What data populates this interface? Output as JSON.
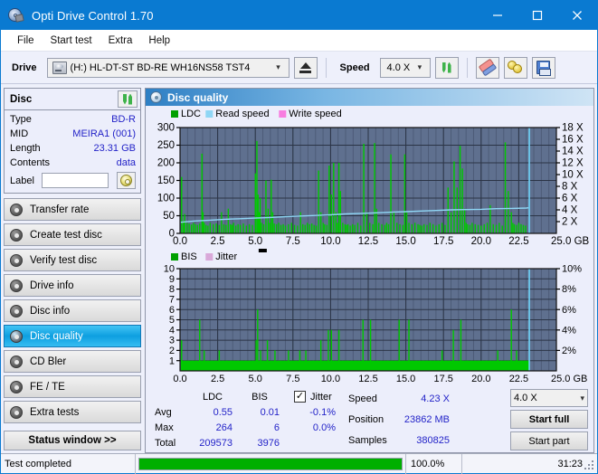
{
  "window": {
    "title": "Opti Drive Control 1.70",
    "icon": "disc-drive-icon",
    "minimize": "minimize-icon",
    "maximize": "maximize-icon",
    "close": "close-icon"
  },
  "menu": {
    "items": [
      {
        "label": "File"
      },
      {
        "label": "Start test"
      },
      {
        "label": "Extra"
      },
      {
        "label": "Help"
      }
    ]
  },
  "toolbar": {
    "drive_label": "Drive",
    "drive_value": "(H:)  HL-DT-ST BD-RE  WH16NS58 TST4",
    "eject_icon": "eject-icon",
    "speed_label": "Speed",
    "speed_value": "4.0 X",
    "refresh_icon": "refresh-icon",
    "eraser_icon": "eraser-icon",
    "coins_icon": "coins-icon",
    "save_icon": "floppy-save-icon"
  },
  "disc_panel": {
    "title": "Disc",
    "refresh_icon": "refresh-icon",
    "rows": [
      {
        "key": "Type",
        "value": "BD-R"
      },
      {
        "key": "MID",
        "value": "MEIRA1 (001)"
      },
      {
        "key": "Length",
        "value": "23.31 GB"
      },
      {
        "key": "Contents",
        "value": "data"
      }
    ],
    "label_key": "Label",
    "label_value": "",
    "label_placeholder": "",
    "label_button_icon": "cd-icon"
  },
  "sidebar": {
    "items": [
      {
        "label": "Transfer rate",
        "icon": "disc-test-icon",
        "active": false
      },
      {
        "label": "Create test disc",
        "icon": "disc-test-icon",
        "active": false
      },
      {
        "label": "Verify test disc",
        "icon": "disc-test-icon",
        "active": false
      },
      {
        "label": "Drive info",
        "icon": "disc-test-icon",
        "active": false
      },
      {
        "label": "Disc info",
        "icon": "disc-test-icon",
        "active": false
      },
      {
        "label": "Disc quality",
        "icon": "disc-test-icon",
        "active": true
      },
      {
        "label": "CD Bler",
        "icon": "disc-test-icon",
        "active": false
      },
      {
        "label": "FE / TE",
        "icon": "disc-test-icon",
        "active": false
      },
      {
        "label": "Extra tests",
        "icon": "disc-test-icon",
        "active": false
      }
    ],
    "status_button": "Status window >>"
  },
  "panel": {
    "title": "Disc quality",
    "icon": "disc-quality-icon"
  },
  "stats": {
    "col_headers": [
      "LDC",
      "BIS"
    ],
    "rows": [
      {
        "label": "Avg",
        "ldc": "0.55",
        "bis": "0.01",
        "jitter": "-0.1%"
      },
      {
        "label": "Max",
        "ldc": "264",
        "bis": "6",
        "jitter": "0.0%"
      },
      {
        "label": "Total",
        "ldc": "209573",
        "bis": "3976",
        "jitter": ""
      }
    ],
    "jitter_label": "Jitter",
    "jitter_checked": "✓",
    "speed_label": "Speed",
    "speed_value": "4.23 X",
    "position_label": "Position",
    "position_value": "23862 MB",
    "samples_label": "Samples",
    "samples_value": "380825",
    "speed_select": "4.0 X",
    "start_full": "Start full",
    "start_part": "Start part"
  },
  "statusbar": {
    "message": "Test completed",
    "percent": "100.0%",
    "progress": 100,
    "elapsed": "31:23"
  },
  "colors": {
    "accent": "#0a7ad1",
    "plot_bg": "#5f708f",
    "grid": "#2b3446",
    "ldc_green": "#00c800",
    "read_speed_blue": "#79d4f7",
    "write_speed_pink": "#f87de0",
    "jitter_pink": "#d9a8d9",
    "value_blue": "#2323c8",
    "progress_green": "#00af00"
  },
  "chart_data": [
    {
      "type": "bar",
      "name": "quality-chart-ldc",
      "title": "",
      "xlabel": "GB",
      "ylabel": "LDC",
      "xlim": [
        0,
        25
      ],
      "ylim": [
        0,
        300
      ],
      "y2lim": [
        0,
        18
      ],
      "y2label": "X",
      "grid": true,
      "legend": [
        "LDC",
        "Read speed",
        "Write speed"
      ],
      "legend_colors": [
        "#00a000",
        "#8fd6f5",
        "#f87de0"
      ],
      "yticks": [
        0,
        50,
        100,
        150,
        200,
        250,
        300
      ],
      "y2ticks": [
        2,
        4,
        6,
        8,
        10,
        12,
        14,
        16,
        18
      ],
      "y2ticklabels": [
        "2 X",
        "4 X",
        "6 X",
        "8 X",
        "10 X",
        "12 X",
        "14 X",
        "16 X",
        "18 X"
      ],
      "xticks": [
        0.0,
        2.5,
        5.0,
        7.5,
        10.0,
        12.5,
        15.0,
        17.5,
        20.0,
        22.5,
        25.0
      ],
      "xticklabels": [
        "0.0",
        "2.5",
        "5.0",
        "7.5",
        "10.0",
        "12.5",
        "15.0",
        "17.5",
        "20.0",
        "22.5",
        "25.0 GB"
      ],
      "series": [
        {
          "name": "LDC",
          "color": "#00c800",
          "x": [
            0.1,
            0.22,
            0.3,
            0.45,
            0.6,
            0.75,
            0.88,
            1.0,
            1.15,
            1.3,
            1.45,
            1.52,
            1.6,
            1.72,
            1.85,
            2.0,
            2.2,
            2.4,
            2.6,
            2.75,
            2.9,
            3.05,
            3.2,
            3.35,
            3.45,
            3.55,
            3.7,
            3.85,
            4.0,
            4.2,
            4.4,
            4.6,
            4.8,
            5.0,
            5.1,
            5.18,
            5.25,
            5.32,
            5.4,
            5.55,
            5.7,
            5.85,
            5.95,
            6.05,
            6.15,
            6.25,
            6.4,
            6.55,
            6.7,
            6.85,
            7.0,
            7.2,
            7.4,
            7.6,
            7.8,
            8.0,
            8.15,
            8.3,
            8.45,
            8.6,
            8.75,
            8.9,
            9.05,
            9.2,
            9.35,
            9.5,
            9.6,
            9.75,
            9.9,
            10.05,
            10.2,
            10.35,
            10.45,
            10.55,
            10.65,
            10.8,
            10.95,
            11.05,
            11.15,
            11.3,
            11.45,
            11.6,
            11.8,
            12.0,
            12.2,
            12.4,
            12.6,
            12.8,
            12.92,
            13.05,
            13.2,
            13.4,
            13.6,
            13.72,
            13.85,
            14.0,
            14.2,
            14.4,
            14.6,
            14.8,
            14.92,
            15.05,
            15.2,
            15.4,
            15.6,
            15.8,
            15.92,
            16.05,
            16.2,
            16.4,
            16.6,
            16.8,
            17.0,
            17.2,
            17.4,
            17.6,
            17.8,
            18.0,
            18.2,
            18.4,
            18.6,
            18.75,
            18.9,
            19.0,
            19.1,
            19.25,
            19.4,
            19.6,
            19.8,
            20.0,
            20.2,
            20.4,
            20.6,
            20.8,
            21.0,
            21.2,
            21.4,
            21.6,
            21.8,
            22.0,
            22.1,
            22.2,
            22.35,
            22.5,
            22.65,
            22.8,
            22.95,
            23.05,
            23.15
          ],
          "y": [
            160,
            35,
            55,
            30,
            28,
            25,
            30,
            26,
            24,
            28,
            226,
            60,
            30,
            24,
            22,
            30,
            26,
            28,
            24,
            60,
            26,
            24,
            70,
            26,
            24,
            30,
            22,
            26,
            24,
            28,
            22,
            26,
            24,
            170,
            262,
            110,
            60,
            100,
            30,
            26,
            150,
            70,
            30,
            152,
            60,
            28,
            26,
            30,
            24,
            26,
            22,
            26,
            30,
            24,
            22,
            60,
            26,
            24,
            30,
            26,
            28,
            24,
            22,
            178,
            60,
            30,
            26,
            24,
            192,
            110,
            200,
            60,
            30,
            200,
            120,
            30,
            26,
            24,
            26,
            22,
            26,
            24,
            30,
            22,
            254,
            60,
            30,
            26,
            256,
            70,
            30,
            26,
            24,
            30,
            26,
            224,
            60,
            30,
            26,
            24,
            224,
            60,
            30,
            26,
            30,
            26,
            24,
            22,
            26,
            24,
            30,
            26,
            22,
            26,
            30,
            24,
            130,
            60,
            204,
            130,
            248,
            184,
            70,
            30,
            26,
            24,
            30,
            26,
            24,
            22,
            26,
            30,
            80,
            26,
            24,
            30,
            22,
            258,
            120,
            60,
            30,
            26,
            24,
            30,
            26,
            24,
            22
          ]
        },
        {
          "name": "Read speed",
          "color": "#8fd6f5",
          "type": "line",
          "axis": "y2",
          "x": [
            0.05,
            1.0,
            2.0,
            3.0,
            4.0,
            5.0,
            6.0,
            7.0,
            8.0,
            9.0,
            10.0,
            11.0,
            12.0,
            13.0,
            14.0,
            15.0,
            16.0,
            17.0,
            18.0,
            19.0,
            20.0,
            21.0,
            22.0,
            23.0,
            23.15
          ],
          "y": [
            1.9,
            2.1,
            2.25,
            2.4,
            2.5,
            2.6,
            2.7,
            2.85,
            2.95,
            3.05,
            3.15,
            3.3,
            3.4,
            3.5,
            3.6,
            3.7,
            3.8,
            3.9,
            4.0,
            4.05,
            4.1,
            4.2,
            4.25,
            4.3,
            4.35
          ]
        },
        {
          "name": "Write speed",
          "color": "#f87de0",
          "type": "line",
          "x": [],
          "y": []
        },
        {
          "name": "end-marker",
          "color": "#6fd3f8",
          "type": "vline",
          "x": 23.2
        }
      ]
    },
    {
      "type": "bar",
      "name": "quality-chart-bis",
      "title": "",
      "xlabel": "GB",
      "ylabel": "BIS",
      "xlim": [
        0,
        25
      ],
      "ylim": [
        0,
        10
      ],
      "y2lim": [
        0,
        10
      ],
      "y2label": "%",
      "grid": true,
      "legend": [
        "BIS",
        "Jitter"
      ],
      "legend_colors": [
        "#00a000",
        "#d9a8d9"
      ],
      "yticks": [
        1,
        2,
        3,
        4,
        5,
        6,
        7,
        8,
        9,
        10
      ],
      "y2ticks": [
        2,
        4,
        6,
        8,
        10
      ],
      "y2ticklabels": [
        "2%",
        "4%",
        "6%",
        "8%",
        "10%"
      ],
      "xticks": [
        0.0,
        2.5,
        5.0,
        7.5,
        10.0,
        12.5,
        15.0,
        17.5,
        20.0,
        22.5,
        25.0
      ],
      "xticklabels": [
        "0.0",
        "2.5",
        "5.0",
        "7.5",
        "10.0",
        "12.5",
        "15.0",
        "17.5",
        "20.0",
        "22.5",
        "25.0 GB"
      ],
      "series": [
        {
          "name": "BIS",
          "color": "#00c800",
          "baseline": 1,
          "x": [
            0.1,
            0.3,
            0.55,
            0.8,
            1.05,
            1.3,
            1.45,
            1.6,
            1.85,
            2.1,
            2.35,
            2.6,
            2.85,
            3.1,
            3.35,
            3.45,
            3.6,
            3.85,
            4.1,
            4.35,
            4.6,
            4.85,
            5.05,
            5.15,
            5.25,
            5.35,
            5.55,
            5.8,
            6.05,
            6.3,
            6.55,
            6.7,
            6.95,
            7.2,
            7.45,
            7.7,
            7.95,
            8.1,
            8.35,
            8.6,
            8.85,
            9.1,
            9.35,
            9.6,
            9.85,
            10.05,
            10.2,
            10.35,
            10.55,
            10.8,
            11.0,
            11.15,
            11.4,
            11.65,
            11.9,
            12.15,
            12.4,
            12.65,
            12.85,
            13.1,
            13.35,
            13.55,
            13.8,
            14.05,
            14.3,
            14.55,
            14.8,
            14.95,
            15.2,
            15.45,
            15.7,
            15.9,
            16.15,
            16.4,
            16.65,
            16.9,
            17.15,
            17.4,
            17.65,
            17.9,
            18.15,
            18.4,
            18.65,
            18.8,
            19.0,
            19.1,
            19.35,
            19.6,
            19.85,
            20.1,
            20.35,
            20.6,
            20.85,
            21.1,
            21.35,
            21.6,
            21.8,
            22.0,
            22.2,
            22.35,
            22.5,
            22.7,
            22.9,
            23.05
          ],
          "y": [
            3,
            1,
            1,
            1,
            1,
            5,
            1,
            2,
            1,
            1,
            1,
            2,
            1,
            1,
            1,
            1,
            1,
            1,
            1,
            1,
            1,
            1,
            3,
            6,
            1,
            2,
            1,
            3,
            1,
            2,
            1,
            1,
            1,
            2,
            1,
            1,
            2,
            1,
            2,
            1,
            1,
            1,
            3,
            1,
            4,
            4,
            1,
            1,
            4,
            1,
            1,
            1,
            1,
            1,
            1,
            5,
            1,
            5,
            1,
            1,
            1,
            1,
            1,
            1,
            1,
            5,
            1,
            1,
            5,
            1,
            1,
            1,
            1,
            1,
            1,
            1,
            1,
            2,
            1,
            1,
            4,
            1,
            5,
            1,
            1,
            1,
            1,
            1,
            1,
            1,
            1,
            1,
            1,
            2,
            1,
            1,
            1,
            6,
            1,
            2,
            1,
            1,
            1,
            1
          ]
        },
        {
          "name": "Jitter",
          "color": "#d9a8d9",
          "type": "line",
          "x": [],
          "y": []
        },
        {
          "name": "end-marker",
          "color": "#6fd3f8",
          "type": "vline",
          "x": 23.2
        }
      ]
    }
  ]
}
